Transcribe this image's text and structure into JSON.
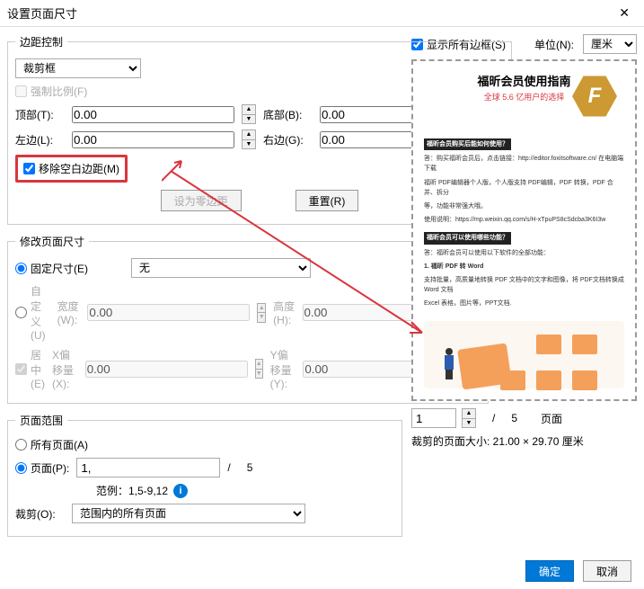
{
  "window": {
    "title": "设置页面尺寸"
  },
  "margin": {
    "legend": "边距控制",
    "box_type": "裁剪框",
    "force_ratio": "强制比例(F)",
    "top": "顶部(T):",
    "bottom": "底部(B):",
    "left": "左边(L):",
    "right": "右边(G):",
    "val_top": "0.00",
    "val_bottom": "0.00",
    "val_left": "0.00",
    "val_right": "0.00",
    "remove_white": "移除空白边距(M)",
    "zero_margin": "设为零边距",
    "reset": "重置(R)"
  },
  "size": {
    "legend": "修改页面尺寸",
    "fixed": "固定尺寸(E)",
    "none": "无",
    "custom": "自定义(U)",
    "width": "宽度(W):",
    "val_w": "0.00",
    "height": "高度(H):",
    "val_h": "0.00",
    "center": "居中(E)",
    "xoff": "X偏移量(X):",
    "val_x": "0.00",
    "yoff": "Y偏移量(Y):",
    "val_y": "0.00"
  },
  "range": {
    "legend": "页面范围",
    "all": "所有页面(A)",
    "pages": "页面(P):",
    "val_pages": "1,",
    "sep": "/",
    "total": "5",
    "example": "范例：1,5-9,12",
    "crop": "裁剪(O):",
    "crop_val": "范围内的所有页面"
  },
  "preview": {
    "show_all": "显示所有边框(S)",
    "unit_lbl": "单位(N):",
    "unit": "厘米",
    "doc_title": "福昕会员使用指南",
    "doc_sub": "全球 5.6 亿用户的选择",
    "q1": "福昕会员购买后能如何使用？",
    "a1": "答：购买福昕会员后，点击链接：http://editor.foxitsoftware.cn/ 在电脑端下载",
    "a1b": "福昕 PDF编辑器个人版，个人版支持 PDF编辑，PDF 转换，PDF 合并、拆分",
    "a1c": "等，功能非常强大哦。",
    "a1d": "使用说明：https://mp.weixin.qq.com/s/H-xTpuPS8cSdcba3K6I3w",
    "q2": "福昕会员可以使用哪些功能？",
    "a2": "答：福昕会员可以使用以下软件的全部功能：",
    "b1": "1. 福昕 PDF 转 Word",
    "b2": "支持批量，高质量地转换 PDF 文档中的文字和图像，将 PDF文档转换成 Word 文档",
    "b3": "Excel 表格，图片等，PPT文档.",
    "page_cur": "1",
    "page_sep": "/",
    "page_total": "5",
    "page_lbl": "页面",
    "crop_size": "裁剪的页面大小: 21.00 × 29.70 厘米"
  },
  "buttons": {
    "ok": "确定",
    "cancel": "取消"
  }
}
